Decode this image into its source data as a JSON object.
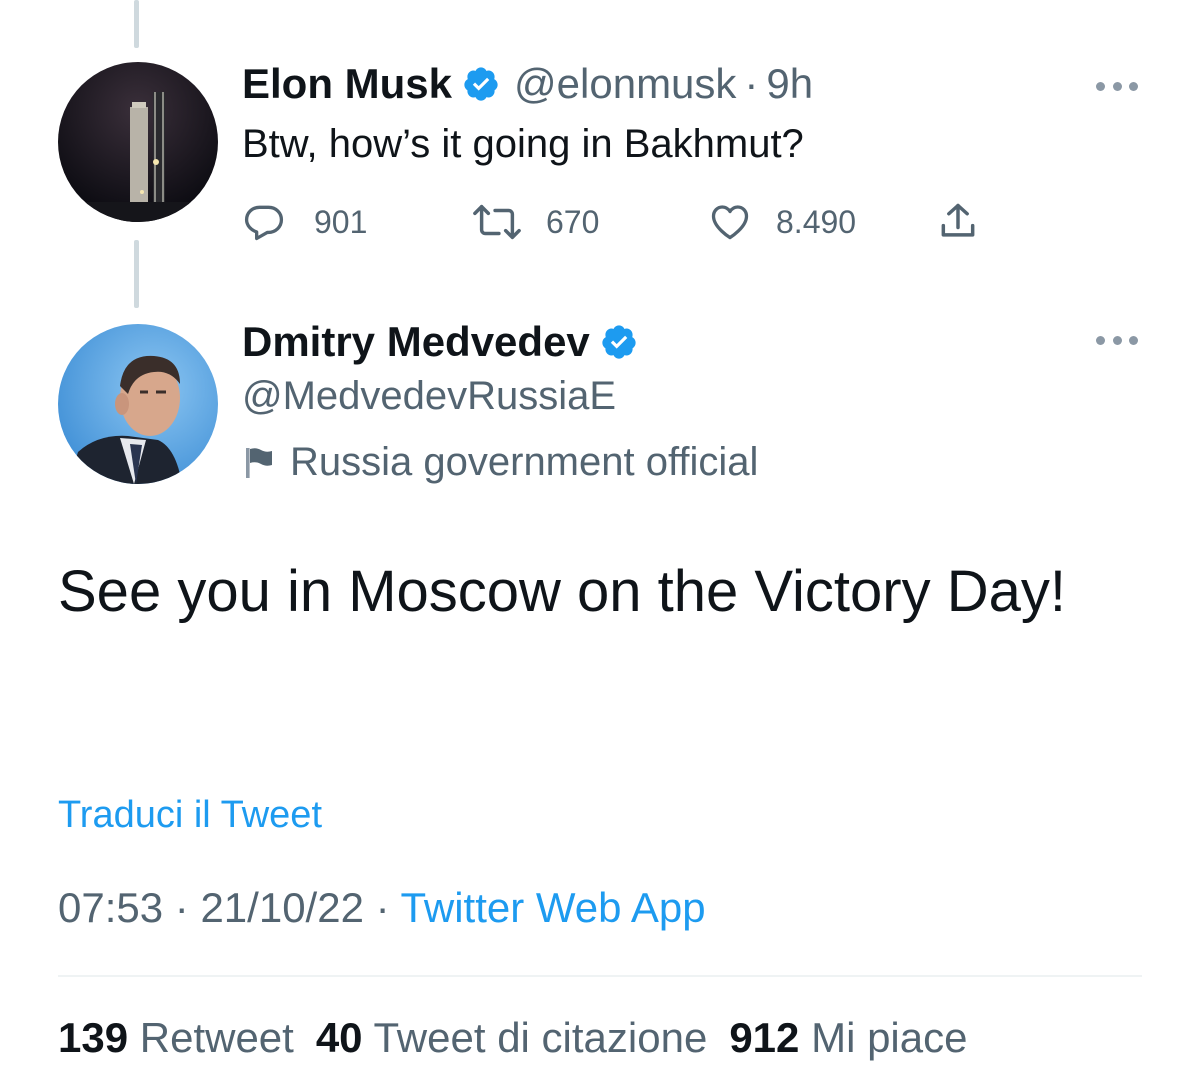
{
  "parent_tweet": {
    "author_name": "Elon Musk",
    "author_handle": "@elonmusk",
    "separator": "·",
    "time_ago": "9h",
    "text": "Btw, how’s it going in Bakhmut?",
    "replies": "901",
    "retweets": "670",
    "likes": "8.490",
    "avatar_icon": "rocket-launch-photo"
  },
  "main_tweet": {
    "author_name": "Dmitry Medvedev",
    "author_handle": "@MedvedevRussiaE",
    "account_label": "Russia government official",
    "text": "See you in Moscow on the Victory Day!",
    "translate_label": "Traduci il Tweet",
    "time": "07:53",
    "date": "21/10/22",
    "separator": "·",
    "source": "Twitter Web App",
    "stats": {
      "retweets_count": "139",
      "retweets_label": "Retweet",
      "quotes_count": "40",
      "quotes_label": "Tweet di citazione",
      "likes_count": "912",
      "likes_label": "Mi piace"
    }
  },
  "colors": {
    "verified": "#1d9bf0",
    "link": "#1d9bf0",
    "secondary_text": "#536471",
    "primary_text": "#0f1419",
    "thread_line": "#cfd9de"
  }
}
